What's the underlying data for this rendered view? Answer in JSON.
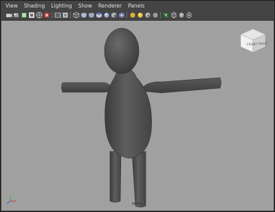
{
  "menu": {
    "items": [
      {
        "id": "view",
        "label": "View"
      },
      {
        "id": "shading",
        "label": "Shading"
      },
      {
        "id": "lighting",
        "label": "Lighting"
      },
      {
        "id": "show",
        "label": "Show"
      },
      {
        "id": "renderer",
        "label": "Renderer"
      },
      {
        "id": "panels",
        "label": "Panels"
      }
    ]
  },
  "toolbar": {
    "icons": [
      "select-camera-icon",
      "camera-attributes-icon",
      "bookmark-icon",
      "image-plane-icon",
      "grid-icon",
      "film-gate-icon",
      "resolution-gate-icon",
      "safe-area-icon",
      "wireframe-icon",
      "smooth-shade-icon",
      "wireframe-on-shaded-icon",
      "textured-icon",
      "use-all-lights-icon",
      "shadows-icon",
      "xray-icon",
      "isolate-select-icon",
      "screenshot-icon",
      "hud-icon",
      "camera-settings-icon"
    ]
  },
  "viewcube": {
    "front_label": "FRONT",
    "side_label": "RIGHT"
  },
  "viewport": {
    "camera_label": "persp",
    "background_color": "#a0a0a0",
    "model_color": "#555555"
  },
  "axes": {
    "x_color": "#d23a3a",
    "y_color": "#3ab53a",
    "z_color": "#3a5bd2"
  }
}
